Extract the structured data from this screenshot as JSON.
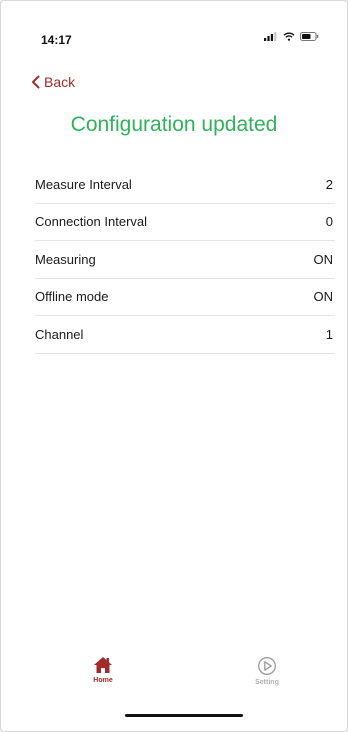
{
  "status_bar": {
    "time": "14:17",
    "icons": [
      "signal-icon",
      "wifi-icon",
      "battery-icon"
    ]
  },
  "nav": {
    "back_label": "Back",
    "back_icon": "chevron-left-icon"
  },
  "page": {
    "title": "Configuration updated"
  },
  "settings": [
    {
      "label": "Measure Interval",
      "value": "2"
    },
    {
      "label": "Connection Interval",
      "value": "0"
    },
    {
      "label": "Measuring",
      "value": "ON"
    },
    {
      "label": "Offline mode",
      "value": "ON"
    },
    {
      "label": "Channel",
      "value": "1"
    }
  ],
  "tabs": [
    {
      "label": "Home",
      "icon": "home-icon",
      "active": true
    },
    {
      "label": "Setting",
      "icon": "play-circle-icon",
      "active": false
    }
  ],
  "colors": {
    "accent": "#a32a2a",
    "title_green": "#2fb25a",
    "inactive_tab": "#b0b0b0",
    "divider": "#e4e4e4"
  }
}
